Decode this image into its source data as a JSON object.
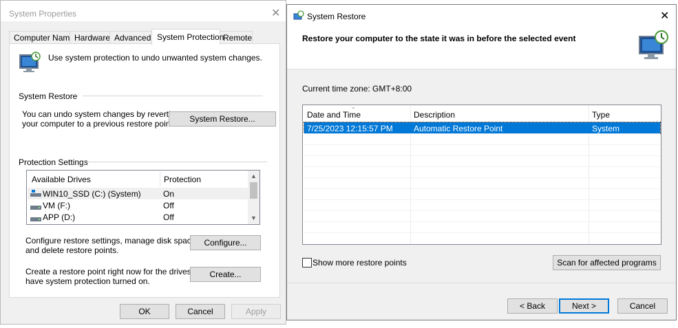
{
  "sysprops": {
    "title": "System Properties",
    "tabs": [
      "Computer Name",
      "Hardware",
      "Advanced",
      "System Protection",
      "Remote"
    ],
    "description": "Use system protection to undo unwanted system changes.",
    "restore_group": "System Restore",
    "restore_text_1": "You can undo system changes by reverting",
    "restore_text_2": "your computer to a previous restore point.",
    "restore_button": "System Restore...",
    "protection_group": "Protection Settings",
    "drives_header": [
      "Available Drives",
      "Protection"
    ],
    "drives": [
      {
        "name": "WIN10_SSD (C:) (System)",
        "protection": "On"
      },
      {
        "name": "VM (F:)",
        "protection": "Off"
      },
      {
        "name": "APP (D:)",
        "protection": "Off"
      }
    ],
    "configure_text_1": "Configure restore settings, manage disk space,",
    "configure_text_2": "and delete restore points.",
    "configure_button": "Configure...",
    "create_text_1": "Create a restore point right now for the drives that",
    "create_text_2": "have system protection turned on.",
    "create_button": "Create...",
    "ok": "OK",
    "cancel": "Cancel",
    "apply": "Apply"
  },
  "restore": {
    "title": "System Restore",
    "heading": "Restore your computer to the state it was in before the selected event",
    "timezone": "Current time zone: GMT+8:00",
    "columns": [
      "Date and Time",
      "Description",
      "Type"
    ],
    "rows": [
      {
        "date": "7/25/2023 12:15:57 PM",
        "description": "Automatic Restore Point",
        "type": "System"
      }
    ],
    "show_more": "Show more restore points",
    "scan": "Scan for affected programs",
    "back": "< Back",
    "next": "Next >",
    "cancel": "Cancel"
  },
  "colors": {
    "selection": "#0078d7",
    "border": "#adadad"
  }
}
